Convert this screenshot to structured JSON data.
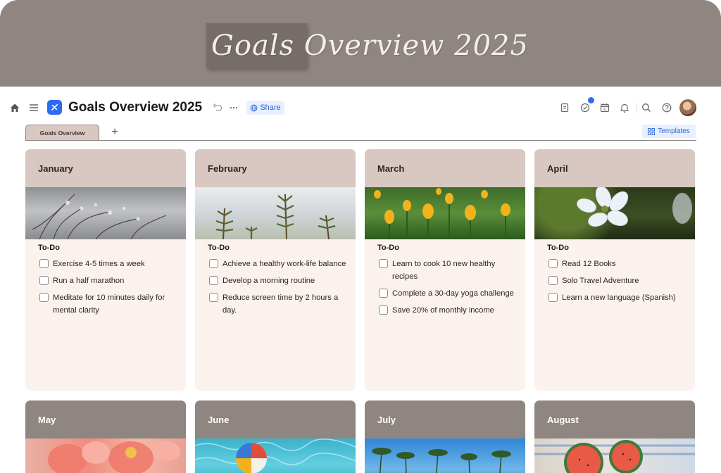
{
  "banner": {
    "title": "Goals Overview 2025"
  },
  "toolbar": {
    "doc_title": "Goals Overview 2025",
    "share_label": "Share",
    "icons": [
      "home-icon",
      "menu-icon",
      "app-logo-icon",
      "undo-icon",
      "more-icon",
      "globe-icon",
      "calendar-icon",
      "tasks-icon",
      "calendar-date-icon",
      "bell-icon",
      "search-icon",
      "help-icon"
    ]
  },
  "tabs": {
    "active": "Goals Overview",
    "add_label": "+"
  },
  "templates_label": "Templates",
  "colors": {
    "banner": "#8f8581",
    "card_header": "#d8c8c1",
    "card_body": "#fbf2ee",
    "accent": "#2c6bf2"
  },
  "months": [
    {
      "name": "January",
      "todo_title": "To-Do",
      "items": [
        "Exercise 4-5 times a week",
        "Run a half marathon",
        "Meditate for 10 minutes daily for mental clarity"
      ]
    },
    {
      "name": "February",
      "todo_title": "To-Do",
      "items": [
        "Achieve a healthy work-life balance",
        "Develop a morning routine",
        "Reduce screen time by 2 hours a day."
      ]
    },
    {
      "name": "March",
      "todo_title": "To-Do",
      "items": [
        "Learn to cook 10 new healthy recipes",
        "Complete a 30-day yoga challenge",
        "Save 20% of monthly income"
      ]
    },
    {
      "name": "April",
      "todo_title": "To-Do",
      "items": [
        "Read 12 Books",
        "Solo Travel Adventure",
        "Learn a new language (Spanish)"
      ]
    },
    {
      "name": "May"
    },
    {
      "name": "June"
    },
    {
      "name": "July"
    },
    {
      "name": "August"
    }
  ]
}
